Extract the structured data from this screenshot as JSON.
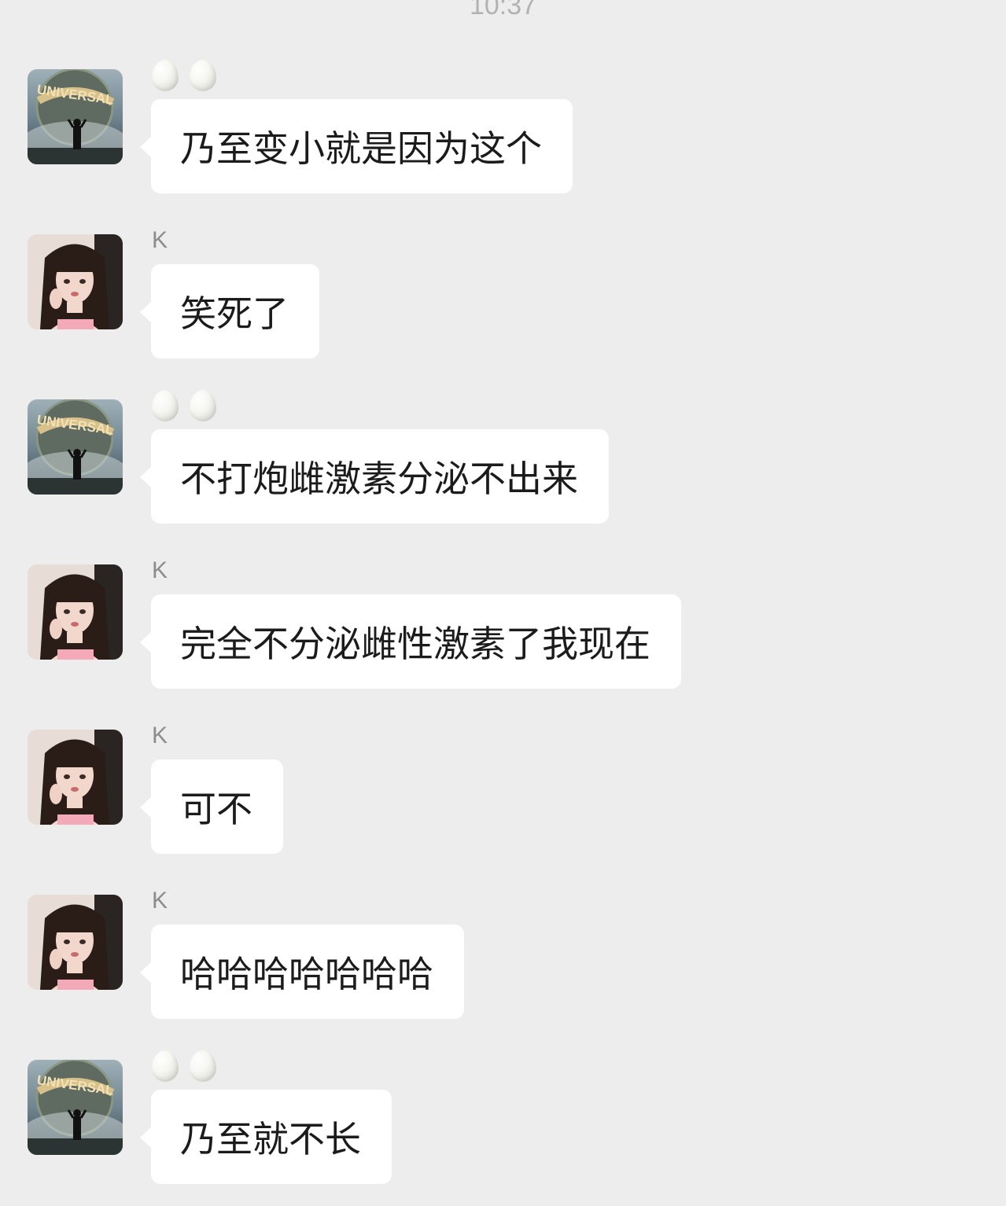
{
  "chat": {
    "timestamp": "10:37",
    "messages": [
      {
        "sender_type": "globe",
        "sender_name": "",
        "text": "乃至变小就是因为这个"
      },
      {
        "sender_type": "girl",
        "sender_name": "K",
        "text": "笑死了"
      },
      {
        "sender_type": "globe",
        "sender_name": "",
        "text": "不打炮雌激素分泌不出来"
      },
      {
        "sender_type": "girl",
        "sender_name": "K",
        "text": "完全不分泌雌性激素了我现在"
      },
      {
        "sender_type": "girl",
        "sender_name": "K",
        "text": "可不"
      },
      {
        "sender_type": "girl",
        "sender_name": "K",
        "text": "哈哈哈哈哈哈哈"
      },
      {
        "sender_type": "globe",
        "sender_name": "",
        "text": "乃至就不长"
      }
    ]
  },
  "avatars": {
    "globe_logo_text": "UNIVERSAL",
    "globe_icon": "universal-globe-avatar",
    "girl_icon": "girl-portrait-avatar",
    "sender_marker_icon": "egg-emoji"
  },
  "colors": {
    "background": "#ededed",
    "bubble": "#ffffff",
    "text": "#1b1b1b",
    "sender_name": "#8c8c8c",
    "timestamp": "#b2b2b2"
  }
}
